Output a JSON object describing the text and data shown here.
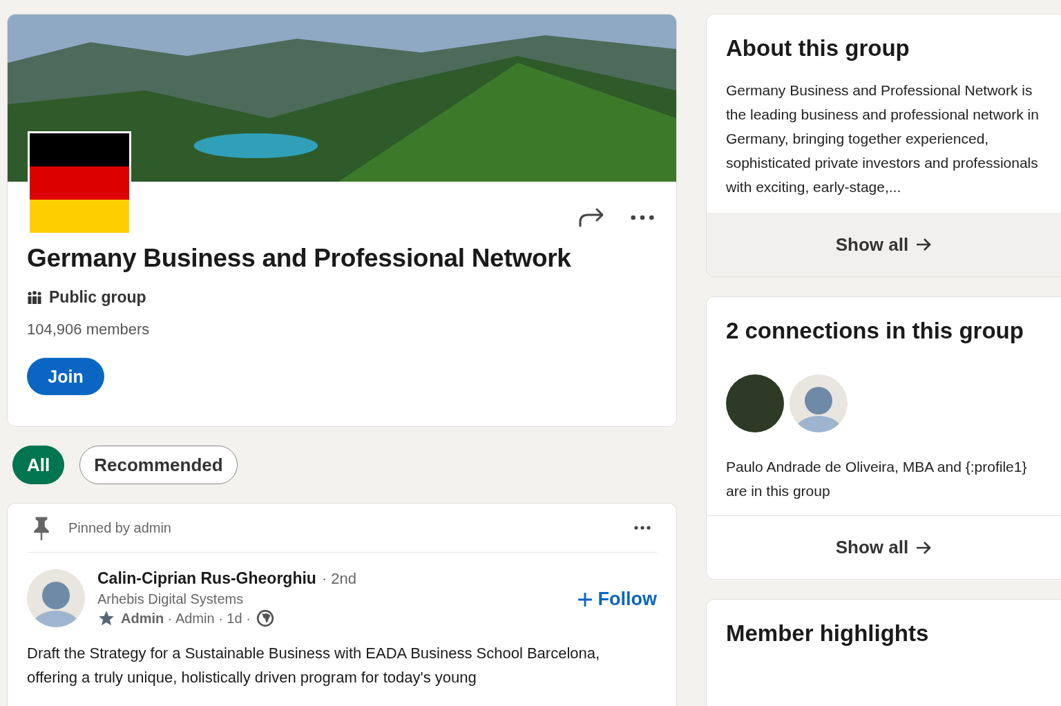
{
  "group": {
    "name": "Germany Business and Professional Network",
    "visibility": "Public group",
    "members": "104,906 members",
    "join_label": "Join"
  },
  "filters": [
    {
      "label": "All",
      "selected": true
    },
    {
      "label": "Recommended",
      "selected": false
    }
  ],
  "pinned_post": {
    "pinned_label": "Pinned by admin",
    "author_name": "Calin-Ciprian Rus-Gheorghiu",
    "degree": "· 2nd",
    "headline": "Arhebis Digital Systems",
    "meta": "**Admin** · Admin · 1d ·",
    "follow_label": "Follow",
    "body": "Draft the Strategy for a Sustainable Business with EADA Business School Barcelona, offering a truly unique, holistically driven program for today's young"
  },
  "about": {
    "title": "About this group",
    "text": "Germany Business and Professional Network is the leading business and professional network in Germany, bringing together experienced, sophisticated private investors and professionals with exciting, early-stage,...",
    "show_all": "Show all"
  },
  "connections": {
    "title": "2 connections in this group",
    "avatars": [
      {
        "kind": "photo"
      },
      {
        "kind": "placeholder"
      }
    ],
    "text": "Paulo Andrade de Oliveira, MBA and {:profile1} are in this group",
    "show_all": "Show all"
  },
  "member_highlights": {
    "title": "Member highlights"
  }
}
